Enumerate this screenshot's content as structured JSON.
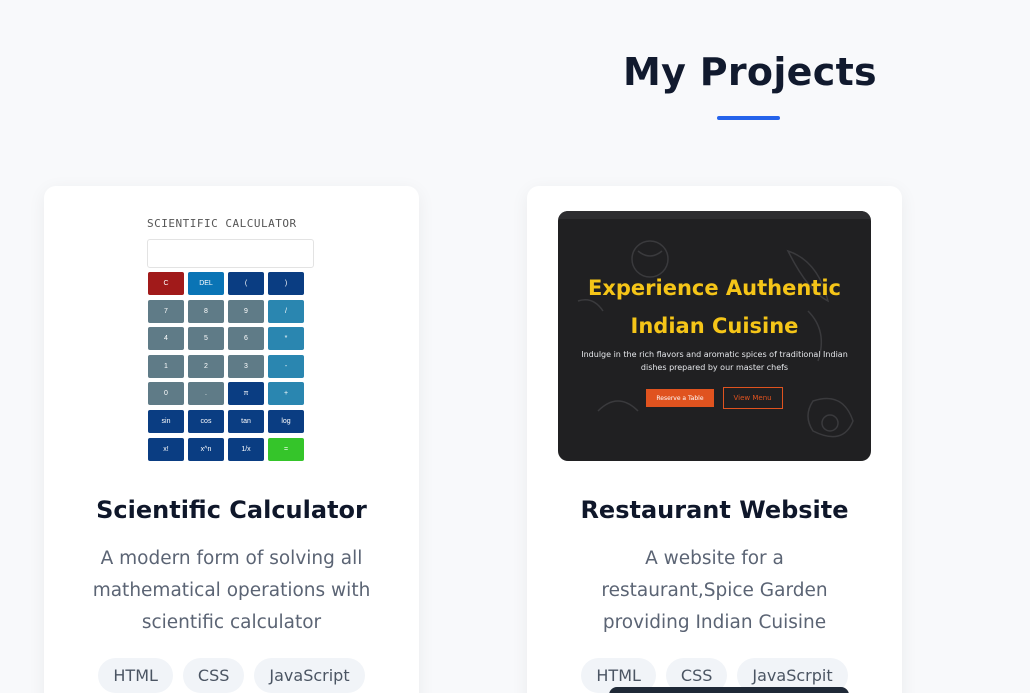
{
  "section": {
    "title": "My Projects"
  },
  "projects": [
    {
      "title": "Scientific Calculator",
      "description": "A modern form of solving all mathematical operations with scientific calculator",
      "tags": [
        "HTML",
        "CSS",
        "JavaScript"
      ],
      "preview": {
        "heading": "SCIENTIFIC CALCULATOR",
        "keys": [
          {
            "label": "C",
            "color": "#a11a1a"
          },
          {
            "label": "DEL",
            "color": "#0a74b5"
          },
          {
            "label": "(",
            "color": "#0a3d82"
          },
          {
            "label": ")",
            "color": "#0a3d82"
          },
          {
            "label": "7",
            "color": "#5f7b87"
          },
          {
            "label": "8",
            "color": "#5f7b87"
          },
          {
            "label": "9",
            "color": "#5f7b87"
          },
          {
            "label": "/",
            "color": "#2a86b0"
          },
          {
            "label": "4",
            "color": "#5f7b87"
          },
          {
            "label": "5",
            "color": "#5f7b87"
          },
          {
            "label": "6",
            "color": "#5f7b87"
          },
          {
            "label": "*",
            "color": "#2a86b0"
          },
          {
            "label": "1",
            "color": "#5f7b87"
          },
          {
            "label": "2",
            "color": "#5f7b87"
          },
          {
            "label": "3",
            "color": "#5f7b87"
          },
          {
            "label": "-",
            "color": "#2a86b0"
          },
          {
            "label": "0",
            "color": "#5f7b87"
          },
          {
            "label": ".",
            "color": "#5f7b87"
          },
          {
            "label": "π",
            "color": "#0a3d82"
          },
          {
            "label": "+",
            "color": "#2a86b0"
          },
          {
            "label": "sin",
            "color": "#0a3d82"
          },
          {
            "label": "cos",
            "color": "#0a3d82"
          },
          {
            "label": "tan",
            "color": "#0a3d82"
          },
          {
            "label": "log",
            "color": "#0a3d82"
          },
          {
            "label": "x!",
            "color": "#0a3d82"
          },
          {
            "label": "x^n",
            "color": "#0a3d82"
          },
          {
            "label": "1/x",
            "color": "#0a3d82"
          },
          {
            "label": "=",
            "color": "#35c52a"
          }
        ]
      }
    },
    {
      "title": "Restaurant Website",
      "description": "A website for a restaurant,Spice Garden providing Indian Cuisine",
      "tags": [
        "HTML",
        "CSS",
        "JavaScrpit"
      ],
      "preview": {
        "headline_line1": "Experience Authentic",
        "headline_line2": "Indian Cuisine",
        "subtext": "Indulge in the rich flavors and aromatic spices of traditional Indian dishes prepared by our master chefs",
        "primary_button": "Reserve a Table",
        "secondary_button": "View Menu"
      }
    }
  ],
  "colors": {
    "accent": "#2563eb",
    "restaurant_headline": "#f5c518",
    "restaurant_button": "#e0531f"
  }
}
